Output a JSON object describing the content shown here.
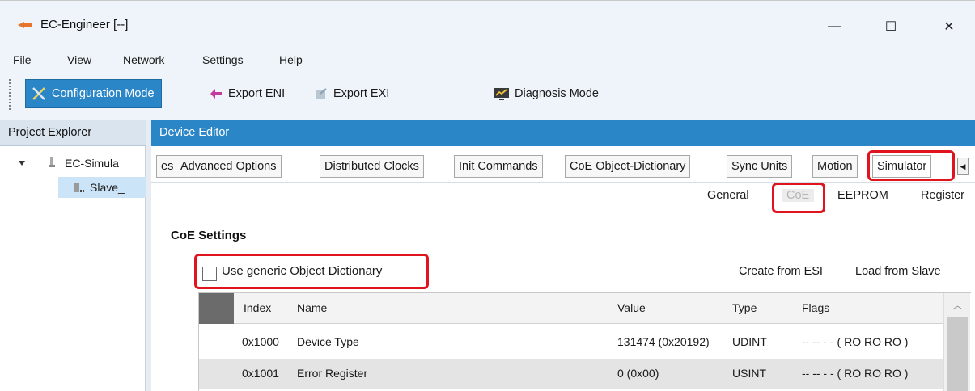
{
  "window": {
    "title": "EC-Engineer [--]",
    "controls": {
      "minimize": "—",
      "maximize": "☐",
      "close": "✕"
    }
  },
  "menu": [
    "File",
    "View",
    "Network",
    "Settings",
    "Help"
  ],
  "toolbar": {
    "configuration_mode": "Configuration Mode",
    "export_eni": "Export ENI",
    "export_exi": "Export EXI",
    "diagnosis_mode": "Diagnosis Mode"
  },
  "project_explorer": {
    "title": "Project Explorer",
    "tree": [
      {
        "label": "EC-Simula",
        "icon": "plug-icon"
      },
      {
        "label": "Slave_",
        "icon": "slave-device-icon"
      }
    ]
  },
  "device_editor": {
    "title": "Device Editor",
    "tabs": [
      "es",
      "Advanced Options",
      "Distributed Clocks",
      "Init Commands",
      "CoE Object-Dictionary",
      "Sync Units",
      "Motion",
      "Simulator"
    ],
    "active_tab": "Simulator",
    "subtabs": [
      "General",
      "CoE",
      "EEPROM",
      "Register"
    ],
    "active_subtab": "CoE"
  },
  "coe_settings": {
    "title": "CoE Settings",
    "use_generic_label": "Use generic Object Dictionary",
    "use_generic_checked": false,
    "create_from_esi": "Create from ESI",
    "load_from_slave": "Load from Slave"
  },
  "table": {
    "columns": [
      "Index",
      "Name",
      "Value",
      "Type",
      "Flags"
    ],
    "rows": [
      [
        "0x1000",
        "Device Type",
        "131474 (0x20192)",
        "UDINT",
        "-- -- - - ( RO RO RO )"
      ],
      [
        "0x1001",
        "Error Register",
        "0 (0x00)",
        "USINT",
        "-- -- - - ( RO RO RO )"
      ]
    ]
  },
  "colors": {
    "accent": "#2b86c8",
    "highlight": "#e0141e",
    "title_background": "#eef4f9"
  }
}
